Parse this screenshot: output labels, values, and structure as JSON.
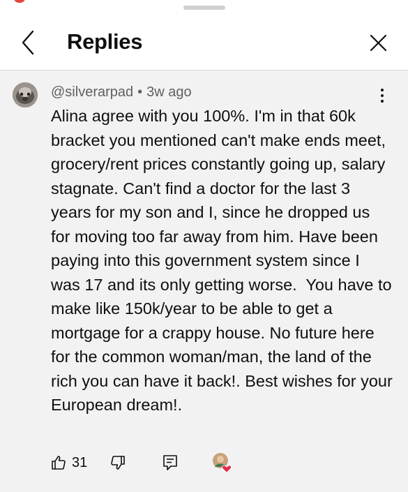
{
  "header": {
    "title": "Replies"
  },
  "comment": {
    "author": "@silverarpad",
    "separator": "•",
    "time_ago": "3w ago",
    "text": "Alina agree with you 100%. I'm in that 60k bracket you mentioned can't make ends meet, grocery/rent prices constantly going up, salary stagnate. Can't find a doctor for the last 3 years for my son and I, since he dropped us for moving too far away from him. Have been paying into this government system since I was 17 and its only getting worse.  You have to make like 150k/year to be able to get a mortgage for a crappy house. No future here for the common woman/man, the land of the rich you can have it back!. Best wishes for your European dream!.",
    "like_count": "31"
  },
  "icons": {
    "back": "chevron-left-icon",
    "close": "close-icon",
    "more": "kebab-menu-icon",
    "like": "thumbs-up-icon",
    "dislike": "thumbs-down-icon",
    "reply": "reply-comment-icon",
    "creator_heart": "heart-icon"
  },
  "colors": {
    "background": "#ffffff",
    "comment_bg": "#f2f2f2",
    "text": "#0f0f0f",
    "meta_text": "#606060",
    "heart": "#e5294b"
  }
}
